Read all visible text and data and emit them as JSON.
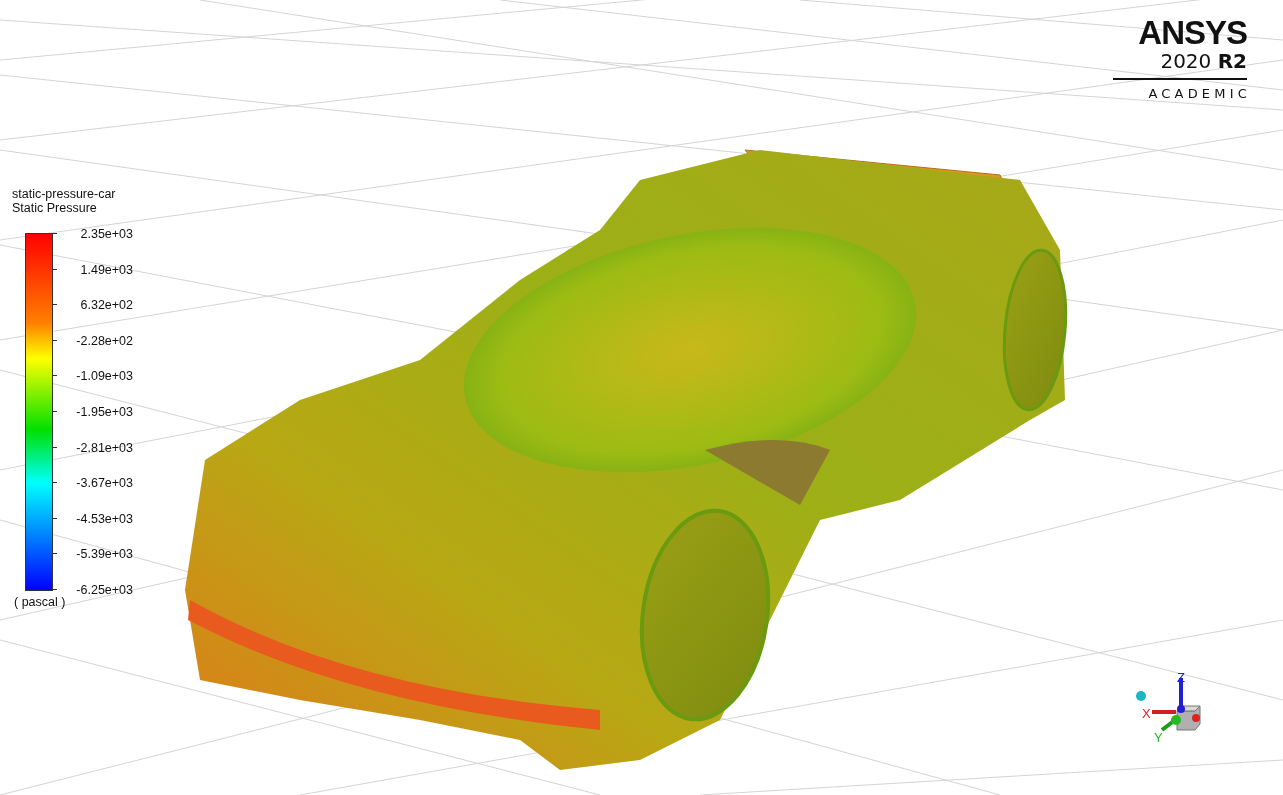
{
  "legend": {
    "title": "static-pressure-car",
    "quantity": "Static Pressure",
    "ticks": [
      "2.35e+03",
      "1.49e+03",
      "6.32e+02",
      "-2.28e+02",
      "-1.09e+03",
      "-1.95e+03",
      "-2.81e+03",
      "-3.67e+03",
      "-4.53e+03",
      "-5.39e+03",
      "-6.25e+03"
    ],
    "unit": "( pascal )"
  },
  "logo": {
    "brand": "ANSYS",
    "version": "2020 **R2**",
    "edition": "ACADEMIC"
  },
  "triad": {
    "x": "X",
    "y": "Y",
    "z": "Z"
  }
}
